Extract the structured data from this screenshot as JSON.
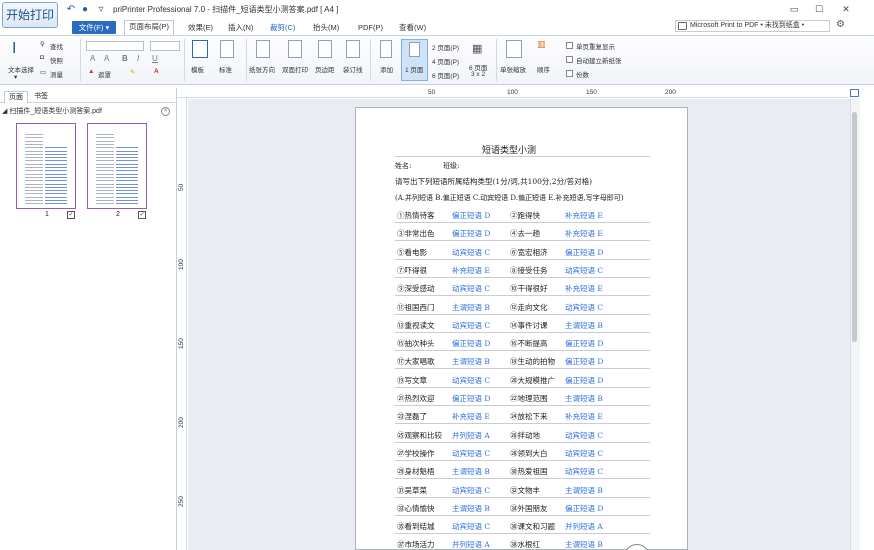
{
  "window": {
    "start_button": "开始打印",
    "title": "priPrinter Professional 7.0 - 扫描件_短语类型小测答案.pdf [ A4 ]",
    "controls": [
      "▭",
      "☐",
      "✕"
    ]
  },
  "menu": {
    "file": "文件(F) ▾",
    "tabs": [
      "页面布局(P)",
      "效果(E)",
      "插入(N)",
      "裁剪(C)",
      "抬头(M)",
      "PDF(P)",
      "查看(W)"
    ],
    "printer": "Microsoft Print to PDF • 未找到纸盒 •"
  },
  "ribbon": {
    "text_select": "文本选择",
    "find": "查找",
    "quick": "快照",
    "measure": "测量",
    "notes": "遮罩",
    "template": "模板",
    "standard": "标准",
    "paper_direction": "纸张方向",
    "duplex": "双面打印",
    "margins": "页边距",
    "binding": "装订线",
    "add": "添加",
    "one_page": "1 页面",
    "two_pages": "2 页面(P)",
    "four_pages": "4 页面(P)",
    "six_pages": "6 页面(P)",
    "six_pages_grid": "6 页面",
    "grid_size": "3 x 2",
    "single_zoom": "单张缩放",
    "order": "顺序",
    "single_repeat": "单页重复显示",
    "auto_new_sheet": "自动建立新纸张",
    "copies": "份数"
  },
  "sidebar": {
    "tabs": [
      "页面",
      "书签"
    ],
    "file": "扫描件_短语类型小测答案.pdf",
    "thumbs": [
      "1",
      "2"
    ]
  },
  "ruler": {
    "h": [
      "50",
      "100",
      "150",
      "200"
    ],
    "v": [
      "50",
      "100",
      "150",
      "200",
      "250"
    ]
  },
  "document": {
    "title": "短语类型小测",
    "name_label": "姓名:",
    "class_label": "班级:",
    "instruction": "请写出下列短语所属结构类型(1分/词,共100分,2分/答对格)",
    "legend": "(A.并列短语 B.偏正短语 C.动宾短语 D.偏正短语 E.补充短语,写字母即可)",
    "rows": [
      {
        "l": "①热情待客",
        "la": "偏正短语 D",
        "r": "②跑得快",
        "ra": "补充短语 E"
      },
      {
        "l": "③非常出色",
        "la": "偏正短语 D",
        "r": "④去一趟",
        "ra": "补充短语 E"
      },
      {
        "l": "⑤看电影",
        "la": "动宾短语 C",
        "r": "⑥宽宏相济",
        "ra": "偏正短语 D"
      },
      {
        "l": "⑦吓得很",
        "la": "补充短语 E",
        "r": "⑧接受任务",
        "ra": "动宾短语 C"
      },
      {
        "l": "⑨深受感动",
        "la": "动宾短语 C",
        "r": "⑩干得很好",
        "ra": "补充短语 E"
      },
      {
        "l": "⑪祖国西门",
        "la": "主谓短语 B",
        "r": "⑫走向文化",
        "ra": "动宾短语 C"
      },
      {
        "l": "⑬重视读文",
        "la": "动宾短语 C",
        "r": "⑭事件讨课",
        "ra": "主谓短语 B"
      },
      {
        "l": "⑮抽次种头",
        "la": "偏正短语 D",
        "r": "⑯不断提高",
        "ra": "偏正短语 D"
      },
      {
        "l": "⑰大家唱歌",
        "la": "主谓短语 B",
        "r": "⑱生动的拍物",
        "ra": "偏正短语 D"
      },
      {
        "l": "⑲写文章",
        "la": "动宾短语 C",
        "r": "⑳大规模推广",
        "ra": "偏正短语 D"
      },
      {
        "l": "㉑热烈欢迎",
        "la": "偏正短语 D",
        "r": "㉒地理范围",
        "ra": "主谓短语 B"
      },
      {
        "l": "㉓涅磊了",
        "la": "补充短语 E",
        "r": "㉔放松下来",
        "ra": "补充短语 E"
      },
      {
        "l": "㉕观察和比较",
        "la": "并列短语 A",
        "r": "㉖拌动地",
        "ra": "动宾短语 C"
      },
      {
        "l": "㉗学校操作",
        "la": "动宾短语 C",
        "r": "㉘领到大白",
        "ra": "动宾短语 C"
      },
      {
        "l": "㉙身材魁梧",
        "la": "主谓短语 B",
        "r": "㉚热爱祖国",
        "ra": "动宾短语 C"
      },
      {
        "l": "㉛吴草菜",
        "la": "动宾短语 C",
        "r": "㉜文物丰",
        "ra": "主谓短语 B"
      },
      {
        "l": "㉝心情愉快",
        "la": "主谓短语 B",
        "r": "㉞外国朋友",
        "ra": "偏正短语 D"
      },
      {
        "l": "㉟看到结城",
        "la": "动宾短语 C",
        "r": "㊱课文和习题",
        "ra": "并列短语 A"
      },
      {
        "l": "㊲市场活力",
        "la": "并列短语 A",
        "r": "㊳水根红",
        "ra": "主谓短语 B"
      }
    ]
  }
}
